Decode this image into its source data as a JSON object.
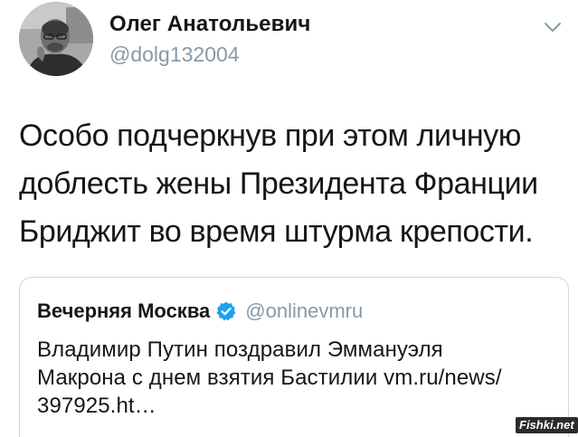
{
  "author": {
    "name": "Олег Анатольевич",
    "handle": "@dolg132004"
  },
  "tweet": {
    "text": "Особо подчеркнув при этом личную\nдоблесть жены Президента Франции\nБриджит во время штурма крепости."
  },
  "quoted_tweet": {
    "name": "Вечерняя Москва",
    "handle": "@onlinevmru",
    "verified": true,
    "text": "Владимир Путин поздравил Эммануэля\nМакрона с днем взятия Бастилии vm.ru/news/\n397925.ht…"
  },
  "watermark": {
    "text": "Fishki.net"
  },
  "icons": {
    "menu": "chevron-down-icon",
    "verified": "verified-badge-icon"
  },
  "colors": {
    "text": "#14171a",
    "secondary": "#8899a6",
    "border": "#ccd6dd",
    "verified": "#1da1f2"
  }
}
